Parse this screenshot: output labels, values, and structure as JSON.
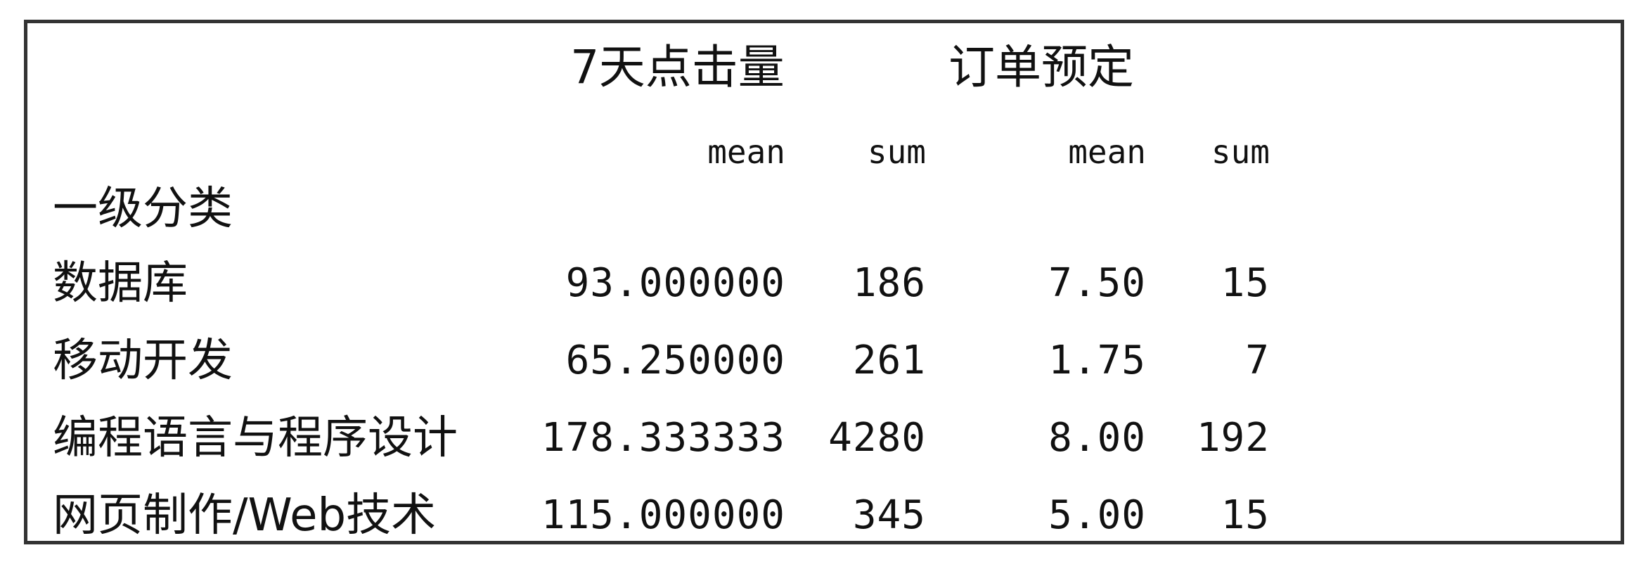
{
  "table": {
    "column_groups": [
      "7天点击量",
      "订单预定"
    ],
    "sub_columns": [
      "mean",
      "sum",
      "mean",
      "sum"
    ],
    "index_name": "一级分类",
    "rows": [
      {
        "label": "数据库",
        "values": [
          "93.000000",
          "186",
          "7.50",
          "15"
        ]
      },
      {
        "label": "移动开发",
        "values": [
          "65.250000",
          "261",
          "1.75",
          "7"
        ]
      },
      {
        "label": "编程语言与程序设计",
        "values": [
          "178.333333",
          "4280",
          "8.00",
          "192"
        ]
      },
      {
        "label": "网页制作/Web技术",
        "values": [
          "115.000000",
          "345",
          "5.00",
          "15"
        ]
      }
    ]
  }
}
